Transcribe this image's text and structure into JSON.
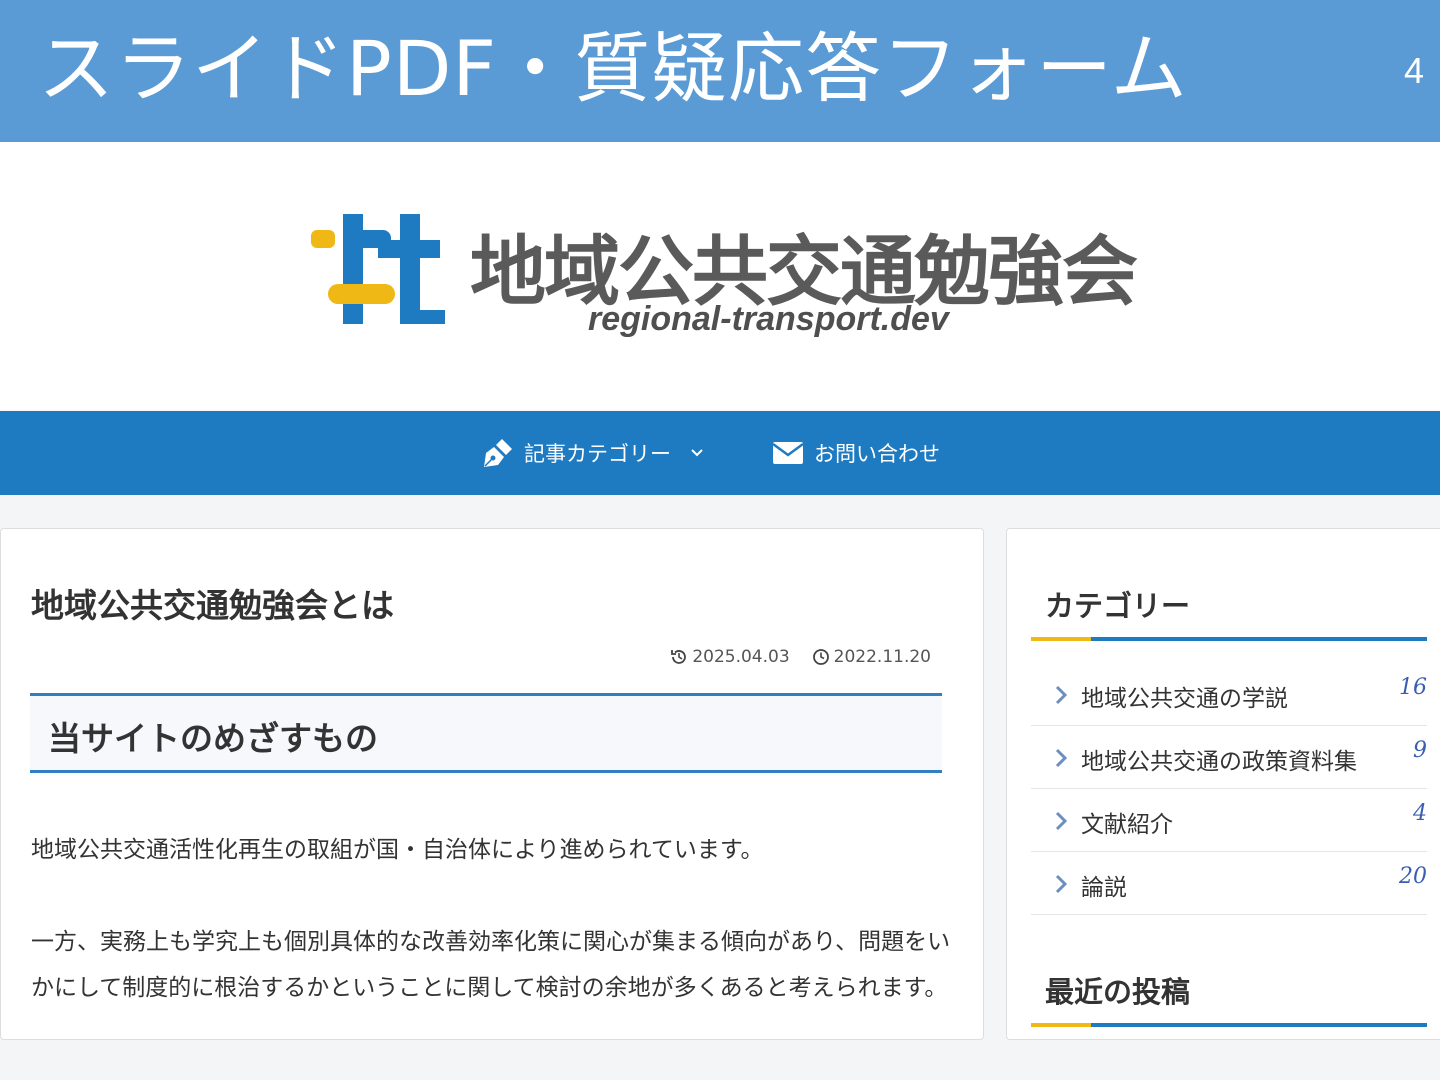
{
  "slide": {
    "title": "スライドPDF・質疑応答フォーム",
    "page_number": "4"
  },
  "site": {
    "name": "地域公共交通勉強会",
    "domain": "regional-transport.dev",
    "logo_icon": "rt-logo-icon"
  },
  "nav": {
    "items": [
      {
        "label": "記事カテゴリー",
        "icon": "pen-icon",
        "has_dropdown": true
      },
      {
        "label": "お問い合わせ",
        "icon": "envelope-icon",
        "has_dropdown": false
      }
    ]
  },
  "article": {
    "title": "地域公共交通勉強会とは",
    "updated_date": "2025.04.03",
    "published_date": "2022.11.20",
    "section_heading": "当サイトのめざすもの",
    "paragraphs": [
      "地域公共交通活性化再生の取組が国・自治体により進められています。",
      "一方、実務上も学究上も個別具体的な改善効率化策に関心が集まる傾向があり、問題をいかにして制度的に根治するかということに関して検討の余地が多くあると考えられます。"
    ]
  },
  "sidebar": {
    "categories_title": "カテゴリー",
    "categories": [
      {
        "label": "地域公共交通の学説",
        "count": "16"
      },
      {
        "label": "地域公共交通の政策資料集",
        "count": "9"
      },
      {
        "label": "文献紹介",
        "count": "4"
      },
      {
        "label": "論説",
        "count": "20"
      }
    ],
    "recent_title": "最近の投稿"
  },
  "colors": {
    "slide_header": "#5b9bd5",
    "navbar": "#1e7bc2",
    "accent_yellow": "#f0b814",
    "logo_blue": "#1e7bc2",
    "count_color": "#3a5fb0"
  }
}
